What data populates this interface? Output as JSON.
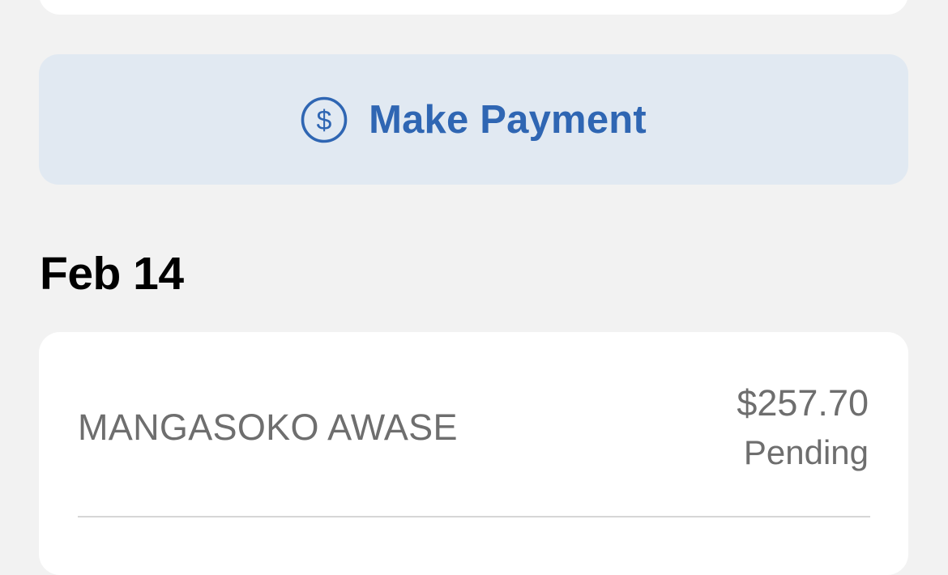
{
  "payment": {
    "button_label": "Make Payment",
    "icon": "dollar-circle-icon",
    "accent_color": "#2f66b3"
  },
  "transactions": {
    "date_heading": "Feb 14",
    "items": [
      {
        "merchant": "MANGASOKO AWASE",
        "amount": "$257.70",
        "status": "Pending"
      }
    ]
  }
}
